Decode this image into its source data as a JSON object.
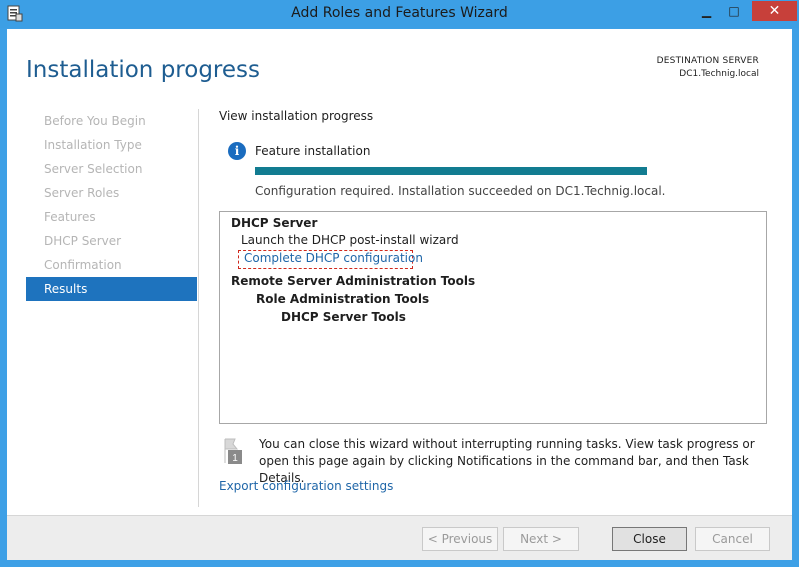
{
  "window": {
    "title": "Add Roles and Features Wizard",
    "controls": {
      "minimize": "▁",
      "maximize": "□",
      "close": "✕"
    }
  },
  "header": {
    "page_title": "Installation progress",
    "destination_label": "DESTINATION SERVER",
    "destination_server": "DC1.Technig.local"
  },
  "nav": {
    "items": [
      {
        "label": "Before You Begin"
      },
      {
        "label": "Installation Type"
      },
      {
        "label": "Server Selection"
      },
      {
        "label": "Server Roles"
      },
      {
        "label": "Features"
      },
      {
        "label": "DHCP Server"
      },
      {
        "label": "Confirmation"
      },
      {
        "label": "Results"
      }
    ],
    "active_index": 7
  },
  "main": {
    "section_head": "View installation progress",
    "feature_label": "Feature installation",
    "progress_fraction": 1.0,
    "status": "Configuration required. Installation succeeded on DC1.Technig.local."
  },
  "results": {
    "dhcp_server": "DHCP Server",
    "launch_wizard": "Launch the DHCP post-install wizard",
    "complete_dhcp_link": "Complete DHCP configuration",
    "rsat": "Remote Server Administration Tools",
    "role_admin_tools": "Role Administration Tools",
    "dhcp_server_tools": "DHCP Server Tools"
  },
  "note": {
    "icon_badge": "1",
    "text": "You can close this wizard without interrupting running tasks. View task progress or open this page again by clicking Notifications in the command bar, and then Task Details."
  },
  "export_link": "Export configuration settings",
  "footer": {
    "previous": "< Previous",
    "next": "Next >",
    "close": "Close",
    "cancel": "Cancel"
  },
  "colors": {
    "titlebar": "#3c9fe5",
    "accent": "#1e73be",
    "progress": "#127c91",
    "link": "#1f66a8",
    "highlight": "#d0291d"
  },
  "icons": {
    "app": "server-manager-icon",
    "info": "info-icon",
    "note": "flag-notification-icon"
  }
}
